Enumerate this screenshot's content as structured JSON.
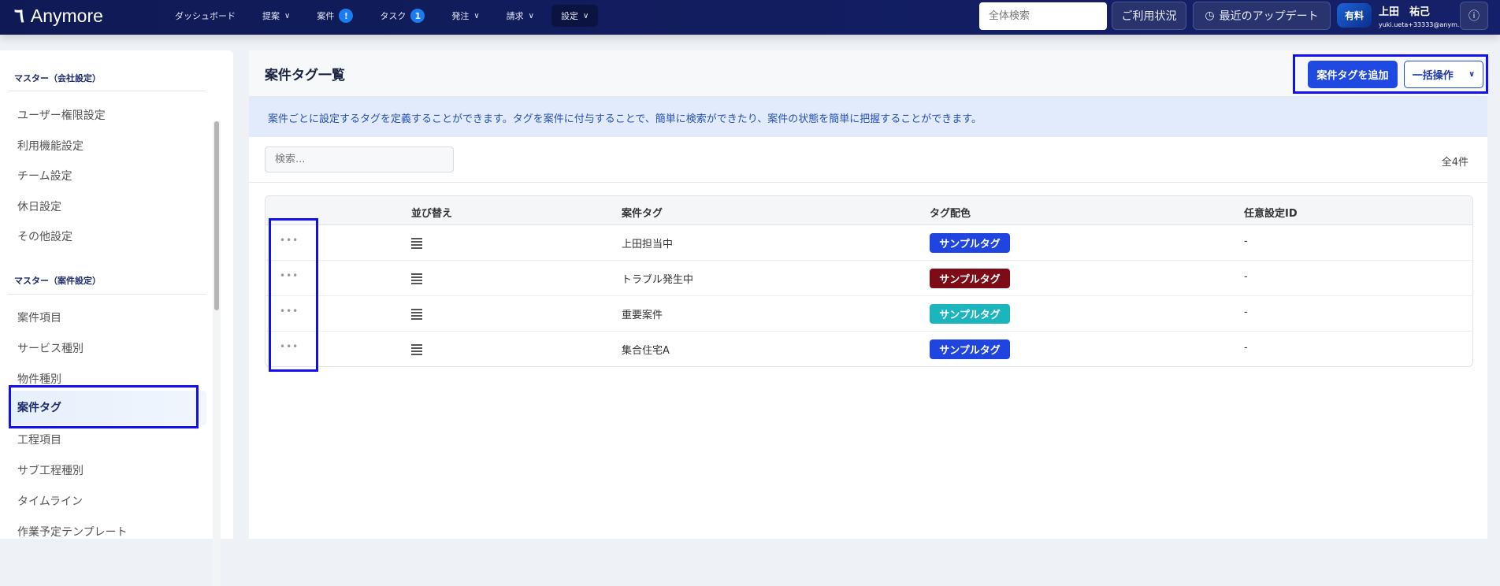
{
  "nav": {
    "logo": "Anymore",
    "items": [
      {
        "label": "ダッシュボード"
      },
      {
        "label": "提案",
        "chevron": true
      },
      {
        "label": "案件",
        "badge": "!"
      },
      {
        "label": "タスク",
        "badge": "1"
      },
      {
        "label": "発注",
        "chevron": true
      },
      {
        "label": "請求",
        "chevron": true
      },
      {
        "label": "設定",
        "chevron": true,
        "active": true
      }
    ],
    "search_placeholder": "全体検索",
    "usage": "ご利用状況",
    "updates": "最近のアップデート",
    "plan": "有料",
    "user_name": "上田　祐己",
    "user_email": "yuki.ueta+33333@anym..."
  },
  "sidebar": {
    "section1": "マスター（会社設定）",
    "items1": [
      "ユーザー権限設定",
      "利用機能設定",
      "チーム設定",
      "休日設定",
      "その他設定"
    ],
    "section2": "マスター（案件設定）",
    "items2": [
      "案件項目",
      "サービス種別",
      "物件種別",
      "案件タグ",
      "工程項目",
      "サブ工程種別",
      "タイムライン",
      "作業予定テンプレート"
    ]
  },
  "main": {
    "title": "案件タグ一覧",
    "add_button": "案件タグを追加",
    "bulk_button": "一括操作",
    "info": "案件ごとに設定するタグを定義することができます。タグを案件に付与することで、簡単に検索ができたり、案件の状態を簡単に把握することができます。",
    "search_placeholder": "検索...",
    "count": "全4件",
    "columns": [
      "並び替え",
      "案件タグ",
      "タグ配色",
      "任意設定ID"
    ],
    "rows": [
      {
        "name": "上田担当中",
        "tag": "サンプルタグ",
        "color": "#1f44e0",
        "id": "-"
      },
      {
        "name": "トラブル発生中",
        "tag": "サンプルタグ",
        "color": "#7e0c16",
        "id": "-"
      },
      {
        "name": "重要案件",
        "tag": "サンプルタグ",
        "color": "#1bb5bd",
        "id": "-"
      },
      {
        "name": "集合住宅A",
        "tag": "サンプルタグ",
        "color": "#1f44e0",
        "id": "-"
      }
    ]
  }
}
